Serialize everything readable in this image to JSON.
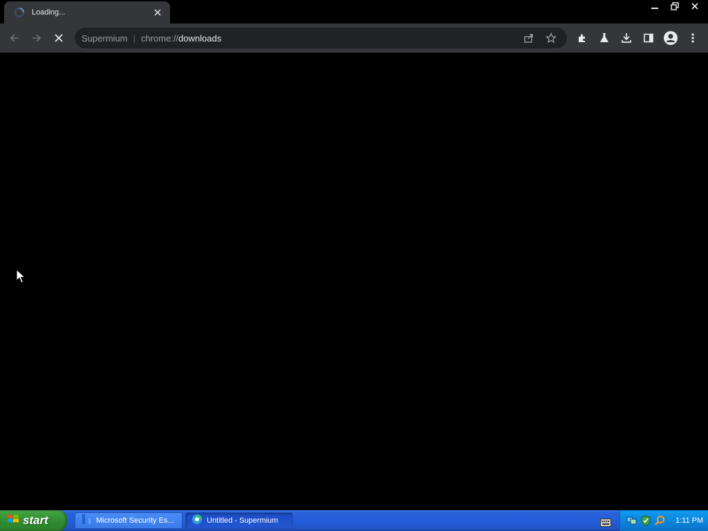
{
  "browser": {
    "tab": {
      "title": "Loading..."
    },
    "omnibox": {
      "host_label": "Supermium",
      "separator": "|",
      "url_scheme": "chrome://",
      "url_path": "downloads"
    },
    "toolbar_icons": [
      "share-icon",
      "bookmark-star-icon",
      "extensions-icon",
      "labs-flask-icon",
      "download-icon",
      "side-panel-icon",
      "profile-avatar-icon",
      "menu-kebab-icon"
    ]
  },
  "taskbar": {
    "start_label": "start",
    "tasks": [
      {
        "label": "Microsoft Security Es...",
        "icon": "security-essentials-icon",
        "active": false
      },
      {
        "label": "Untitled - Supermium",
        "icon": "supermium-icon",
        "active": true
      }
    ],
    "clock": "1:11 PM"
  },
  "colors": {
    "tab_bg": "#35363a",
    "omnibox_bg": "#202124",
    "taskbar_blue": "#245ddb",
    "start_green": "#3c9c3c",
    "tray_blue": "#0b87df"
  }
}
